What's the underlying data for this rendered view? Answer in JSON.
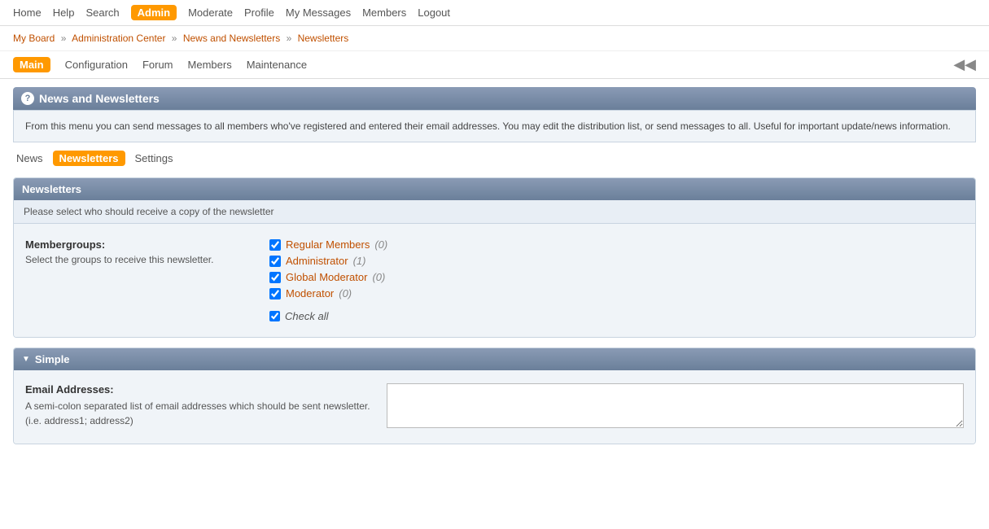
{
  "topnav": {
    "items": [
      {
        "label": "Home",
        "href": "#"
      },
      {
        "label": "Help",
        "href": "#"
      },
      {
        "label": "Search",
        "href": "#"
      },
      {
        "label": "Admin",
        "href": "#",
        "active": true
      },
      {
        "label": "Moderate",
        "href": "#"
      },
      {
        "label": "Profile",
        "href": "#"
      },
      {
        "label": "My Messages",
        "href": "#"
      },
      {
        "label": "Members",
        "href": "#"
      },
      {
        "label": "Logout",
        "href": "#"
      }
    ]
  },
  "breadcrumb": {
    "items": [
      {
        "label": "My Board",
        "href": "#"
      },
      {
        "label": "Administration Center",
        "href": "#"
      },
      {
        "label": "News and Newsletters",
        "href": "#"
      },
      {
        "label": "Newsletters",
        "href": "#"
      }
    ]
  },
  "subnav": {
    "items": [
      {
        "label": "Main",
        "href": "#",
        "active": true
      },
      {
        "label": "Configuration",
        "href": "#"
      },
      {
        "label": "Forum",
        "href": "#"
      },
      {
        "label": "Members",
        "href": "#"
      },
      {
        "label": "Maintenance",
        "href": "#"
      }
    ],
    "back_icon": "◀◀"
  },
  "section": {
    "title": "News and Newsletters",
    "description": "From this menu you can send messages to all members who've registered and entered their email addresses. You may edit the distribution list, or send messages to all. Useful for important update/news information."
  },
  "tabs": [
    {
      "label": "News",
      "active": false
    },
    {
      "label": "Newsletters",
      "active": true
    },
    {
      "label": "Settings",
      "active": false
    }
  ],
  "newsletters": {
    "header": "Newsletters",
    "subheader": "Please select who should receive a copy of the newsletter",
    "membergroups_label": "Membergroups:",
    "membergroups_desc": "Select the groups to receive this newsletter.",
    "groups": [
      {
        "label": "Regular Members",
        "count": "(0)",
        "checked": true
      },
      {
        "label": "Administrator",
        "count": "(1)",
        "checked": true
      },
      {
        "label": "Global Moderator",
        "count": "(0)",
        "checked": true
      },
      {
        "label": "Moderator",
        "count": "(0)",
        "checked": true
      }
    ],
    "check_all_label": "Check all"
  },
  "simple": {
    "header": "Simple",
    "email_label": "Email Addresses:",
    "email_desc": "A semi-colon separated list of email addresses which should be sent newsletter.",
    "email_example": "(i.e. address1; address2)"
  }
}
